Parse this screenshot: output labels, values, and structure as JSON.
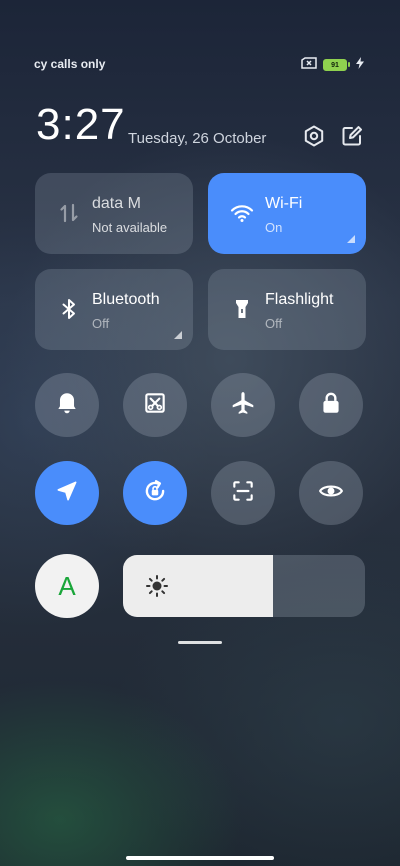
{
  "status_bar": {
    "carrier_text": "cy calls only",
    "battery_level": "91",
    "icons": [
      "sim-error-icon",
      "battery-icon",
      "charging-icon"
    ]
  },
  "header": {
    "time": "3:27",
    "date": "Tuesday, 26 October",
    "icons": [
      "settings-icon",
      "edit-icon"
    ]
  },
  "tiles": [
    {
      "name": "mobile-data",
      "title": "data      M",
      "subtitle": "Not available",
      "active": false,
      "icon": "mobile-data-icon"
    },
    {
      "name": "wifi",
      "title": "Wi-Fi",
      "subtitle": "On",
      "active": true,
      "icon": "wifi-icon"
    },
    {
      "name": "bluetooth",
      "title": "Bluetooth",
      "subtitle": "Off",
      "active": false,
      "icon": "bluetooth-icon"
    },
    {
      "name": "flashlight",
      "title": "Flashlight",
      "subtitle": "Off",
      "active": false,
      "icon": "flashlight-icon"
    }
  ],
  "toggles_row1": [
    "notification-bell-icon",
    "screenshot-icon",
    "airplane-icon",
    "lock-icon"
  ],
  "toggles_row2": [
    {
      "icon": "location-icon",
      "active": true
    },
    {
      "icon": "auto-rotate-icon",
      "active": true
    },
    {
      "icon": "scanner-icon",
      "active": false
    },
    {
      "icon": "eye-icon",
      "active": false
    }
  ],
  "font_button": {
    "label": "A"
  },
  "brightness": {
    "level": 0.62,
    "icon": "sun-icon"
  },
  "colors": {
    "accent": "#4a8dfb",
    "font_button_text": "#1aa63a",
    "battery": "#8fd14f"
  }
}
